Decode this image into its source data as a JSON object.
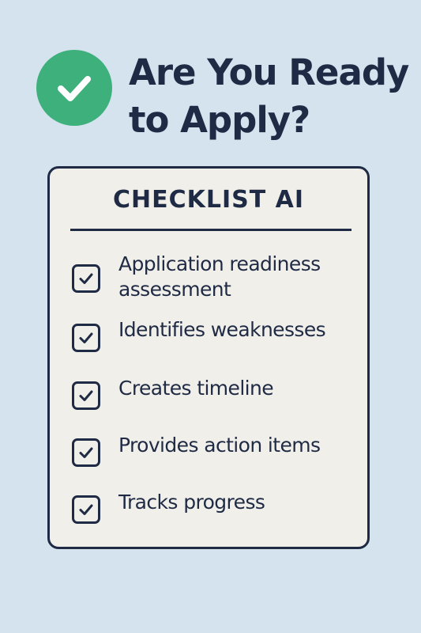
{
  "header": {
    "title": "Are You Ready to Apply?",
    "icon": "checkmark-circle-icon",
    "icon_color": "#3eb07b"
  },
  "checklist": {
    "title": "CHECKLIST AI",
    "items": [
      {
        "label": "Application readiness assessment",
        "icon": "checkbox-checked-icon"
      },
      {
        "label": "Identifies weaknesses",
        "icon": "checkbox-checked-icon"
      },
      {
        "label": "Creates timeline",
        "icon": "checkbox-checked-icon"
      },
      {
        "label": "Provides action items",
        "icon": "checkbox-checked-icon"
      },
      {
        "label": "Tracks progress",
        "icon": "checkbox-checked-icon"
      }
    ]
  },
  "colors": {
    "background": "#d5e3ee",
    "card_background": "#f1efea",
    "text": "#1f2a44",
    "accent": "#3eb07b"
  }
}
